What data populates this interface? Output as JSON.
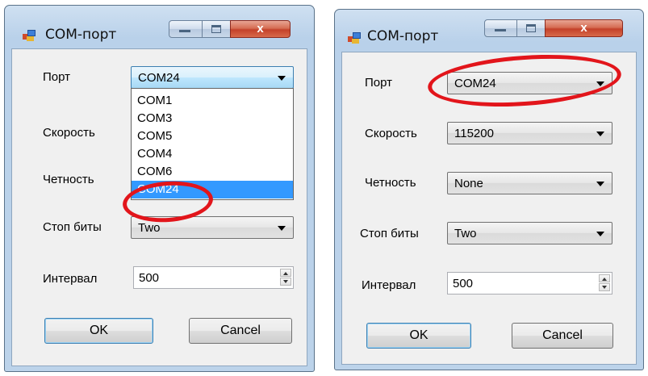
{
  "colors": {
    "highlight_ring": "#e2151b",
    "selection": "#3399ff",
    "close_button": "#c4412a"
  },
  "left_window": {
    "title": "COM-порт",
    "labels": {
      "port": "Порт",
      "speed": "Скорость",
      "parity": "Четность",
      "stop_bits": "Стоп биты",
      "interval": "Интервал"
    },
    "port_value": "COM24",
    "stop_bits_value": "Two",
    "interval_value": "500",
    "port_dropdown_open": true,
    "port_options": [
      "COM1",
      "COM3",
      "COM5",
      "COM4",
      "COM6",
      "COM24"
    ],
    "selected_option_index": 5,
    "ok_label": "OK",
    "cancel_label": "Cancel",
    "close_glyph": "x"
  },
  "right_window": {
    "title": "COM-порт",
    "labels": {
      "port": "Порт",
      "speed": "Скорость",
      "parity": "Четность",
      "stop_bits": "Стоп биты",
      "interval": "Интервал"
    },
    "port_value": "COM24",
    "speed_value": "115200",
    "parity_value": "None",
    "stop_bits_value": "Two",
    "interval_value": "500",
    "ok_label": "OK",
    "cancel_label": "Cancel",
    "close_glyph": "x"
  },
  "icons": {
    "app": "serial-port-app-icon",
    "minimize": "minimize-icon",
    "maximize": "maximize-icon",
    "close": "close-icon",
    "dropdown": "chevron-down-icon",
    "spin_up": "spin-up-icon",
    "spin_down": "spin-down-icon"
  }
}
